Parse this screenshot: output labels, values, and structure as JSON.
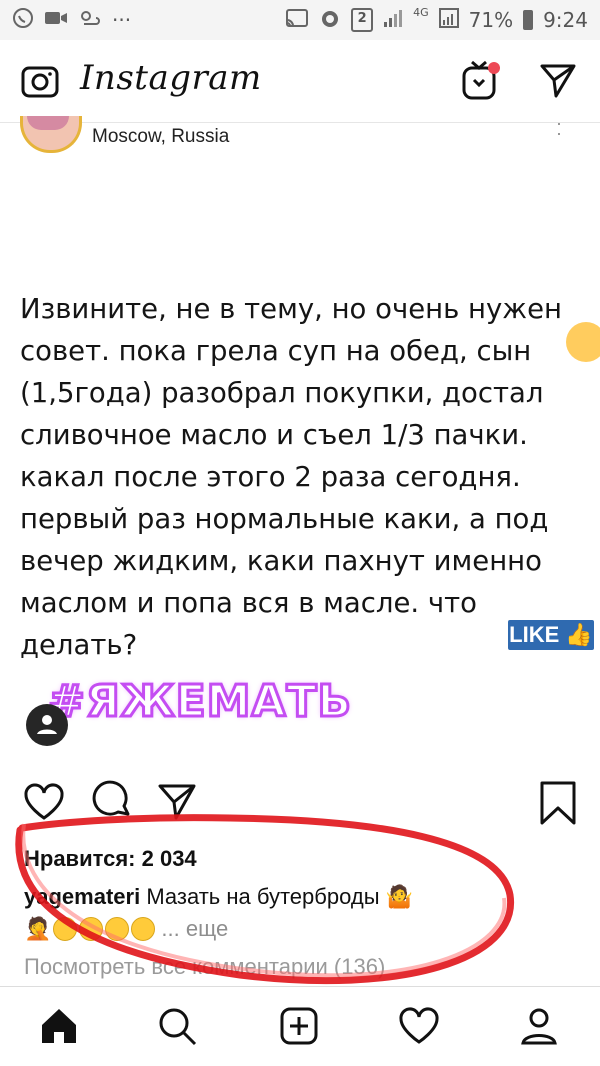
{
  "status_bar": {
    "sim_badge": "2",
    "network": "4G",
    "battery": "71%",
    "time": "9:24"
  },
  "header": {
    "logo": "Instagram",
    "icons": [
      "camera-icon",
      "igtv-icon",
      "direct-message-icon"
    ]
  },
  "post": {
    "location": "Moscow, Russia",
    "text": "Извините, не в тему, но очень нужен\nсовет. пока грела суп на обед, сын\n(1,5года) разобрал покупки, достал\nсливочное масло и съел 1/3 пачки.\nкакал после этого 2 раза сегодня.\nпервый раз нормальные каки, а под\nвечер жидким, каки пахнут именно\nмаслом и попа вся в масле. что\nделать?",
    "like_badge": "LIKE",
    "hashtag": "#ЯЖЕМАТЬ"
  },
  "meta": {
    "likes": "Нравится: 2 034",
    "caption_user": "yagemateri",
    "caption_text": "Мазать на бутерброды",
    "more": "... еще",
    "view_comments": "Посмотреть все комментарии (136)"
  },
  "colors": {
    "annotation_red": "#e0141a",
    "hashtag_purple": "#c44df2",
    "like_blue": "#2f6ab0"
  }
}
